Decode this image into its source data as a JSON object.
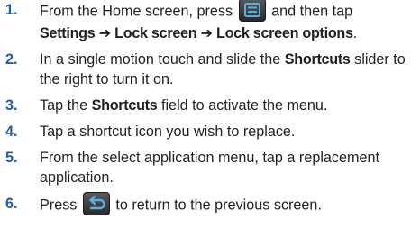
{
  "steps": [
    {
      "number": "1.",
      "text_a": "From the Home screen, press",
      "text_b": "and then tap",
      "path_settings": "Settings",
      "arrow1": " ➔ ",
      "path_lock": "Lock screen",
      "arrow2": " ➔ ",
      "path_options": "Lock screen options",
      "end": "."
    },
    {
      "number": "2.",
      "text_a": "In a single motion touch and slide the ",
      "bold": "Shortcuts",
      "text_b": " slider to the right to turn it on."
    },
    {
      "number": "3.",
      "text_a": "Tap the ",
      "bold": "Shortcuts",
      "text_b": " field to activate the menu."
    },
    {
      "number": "4.",
      "text": "Tap a shortcut icon you wish to replace."
    },
    {
      "number": "5.",
      "text": "From the select application menu, tap a replacement application."
    },
    {
      "number": "6.",
      "text_a": "Press",
      "text_b": "to return to the previous screen."
    }
  ],
  "icons": {
    "menu": "menu-key-icon",
    "back": "back-key-icon"
  },
  "colors": {
    "step_number": "#1f5ea8",
    "body_text": "#231f20",
    "key_background": "#3a3a3a",
    "key_glyph": "#5aaee6"
  }
}
